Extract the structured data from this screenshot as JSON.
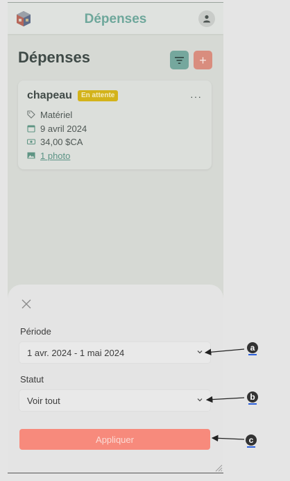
{
  "header": {
    "title": "Dépenses"
  },
  "page": {
    "title": "Dépenses",
    "add_label": "+"
  },
  "expense": {
    "name": "chapeau",
    "status": "En attente",
    "category": "Matériel",
    "date": "9 avril 2024",
    "amount": "34,00 $CA",
    "attachment": "1 photo",
    "more": "···"
  },
  "filter_sheet": {
    "period_label": "Période",
    "period_value": "1 avr. 2024 - 1 mai 2024",
    "status_label": "Statut",
    "status_value": "Voir tout",
    "apply_label": "Appliquer"
  },
  "annotations": [
    "a",
    "b",
    "c"
  ],
  "colors": {
    "accent": "#6ea79b",
    "primary_button": "#f78a7c",
    "badge": "#d3b31a"
  }
}
